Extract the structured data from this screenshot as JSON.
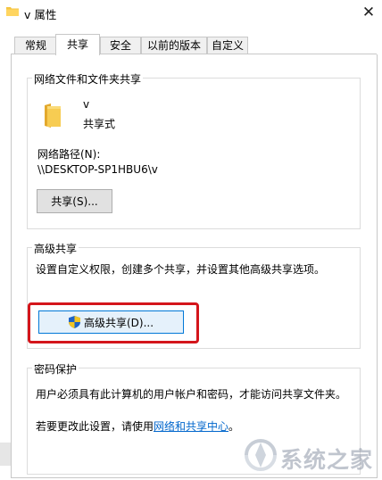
{
  "window": {
    "title": "v 属性",
    "close_glyph": "✕"
  },
  "tabs": [
    {
      "label": "常规",
      "active": false
    },
    {
      "label": "共享",
      "active": true
    },
    {
      "label": "安全",
      "active": false
    },
    {
      "label": "以前的版本",
      "active": false
    },
    {
      "label": "自定义",
      "active": false
    }
  ],
  "network_share": {
    "legend": "网络文件和文件夹共享",
    "folder_name": "v",
    "share_status": "共享式",
    "path_label": "网络路径(N):",
    "path_value": "\\\\DESKTOP-SP1HBU6\\v",
    "share_button": "共享(S)..."
  },
  "advanced_share": {
    "legend": "高级共享",
    "description": "设置自定义权限，创建多个共享，并设置其他高级共享选项。",
    "button": "高级共享(D)..."
  },
  "password": {
    "legend": "密码保护",
    "description": "用户必须具有此计算机的用户帐户和密码，才能访问共享文件夹。",
    "change_prefix": "若要更改此设置，请使用",
    "change_link": "网络和共享中心",
    "change_suffix": "。"
  },
  "watermark": {
    "text": "系统之家"
  },
  "colors": {
    "highlight_box": "#d4151b",
    "link": "#0066cc",
    "folder": "#f5c542"
  },
  "icons": {
    "folder": "folder-icon",
    "shield": "uac-shield-icon",
    "close": "close-icon"
  }
}
